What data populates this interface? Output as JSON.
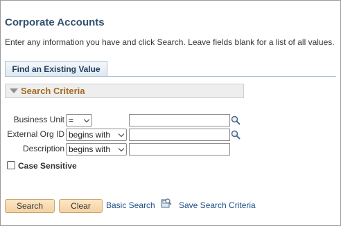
{
  "page": {
    "title": "Corporate Accounts",
    "instructions": "Enter any information you have and click Search. Leave fields blank for a list of all values."
  },
  "tabs": [
    {
      "label": "Find an Existing Value",
      "selected": true
    }
  ],
  "criteria": {
    "header": "Search Criteria",
    "fields": [
      {
        "label": "Business Unit",
        "operator": "=",
        "value": "",
        "has_lookup": true
      },
      {
        "label": "External Org ID",
        "operator": "begins with",
        "value": "",
        "has_lookup": true
      },
      {
        "label": "Description",
        "operator": "begins with",
        "value": "",
        "has_lookup": false
      }
    ],
    "case_sensitive": {
      "label": "Case Sensitive",
      "checked": false
    }
  },
  "actions": {
    "search_label": "Search",
    "clear_label": "Clear",
    "basic_search_label": "Basic Search",
    "save_search_label": "Save Search Criteria"
  },
  "icons": {
    "collapse": "triangle-down-icon",
    "lookup": "magnifier-icon",
    "save_search": "save-search-icon"
  },
  "colors": {
    "title": "#31506e",
    "section_header_text": "#a36a21",
    "button_fill": "#f5d2a0",
    "link": "#1d4e86"
  }
}
